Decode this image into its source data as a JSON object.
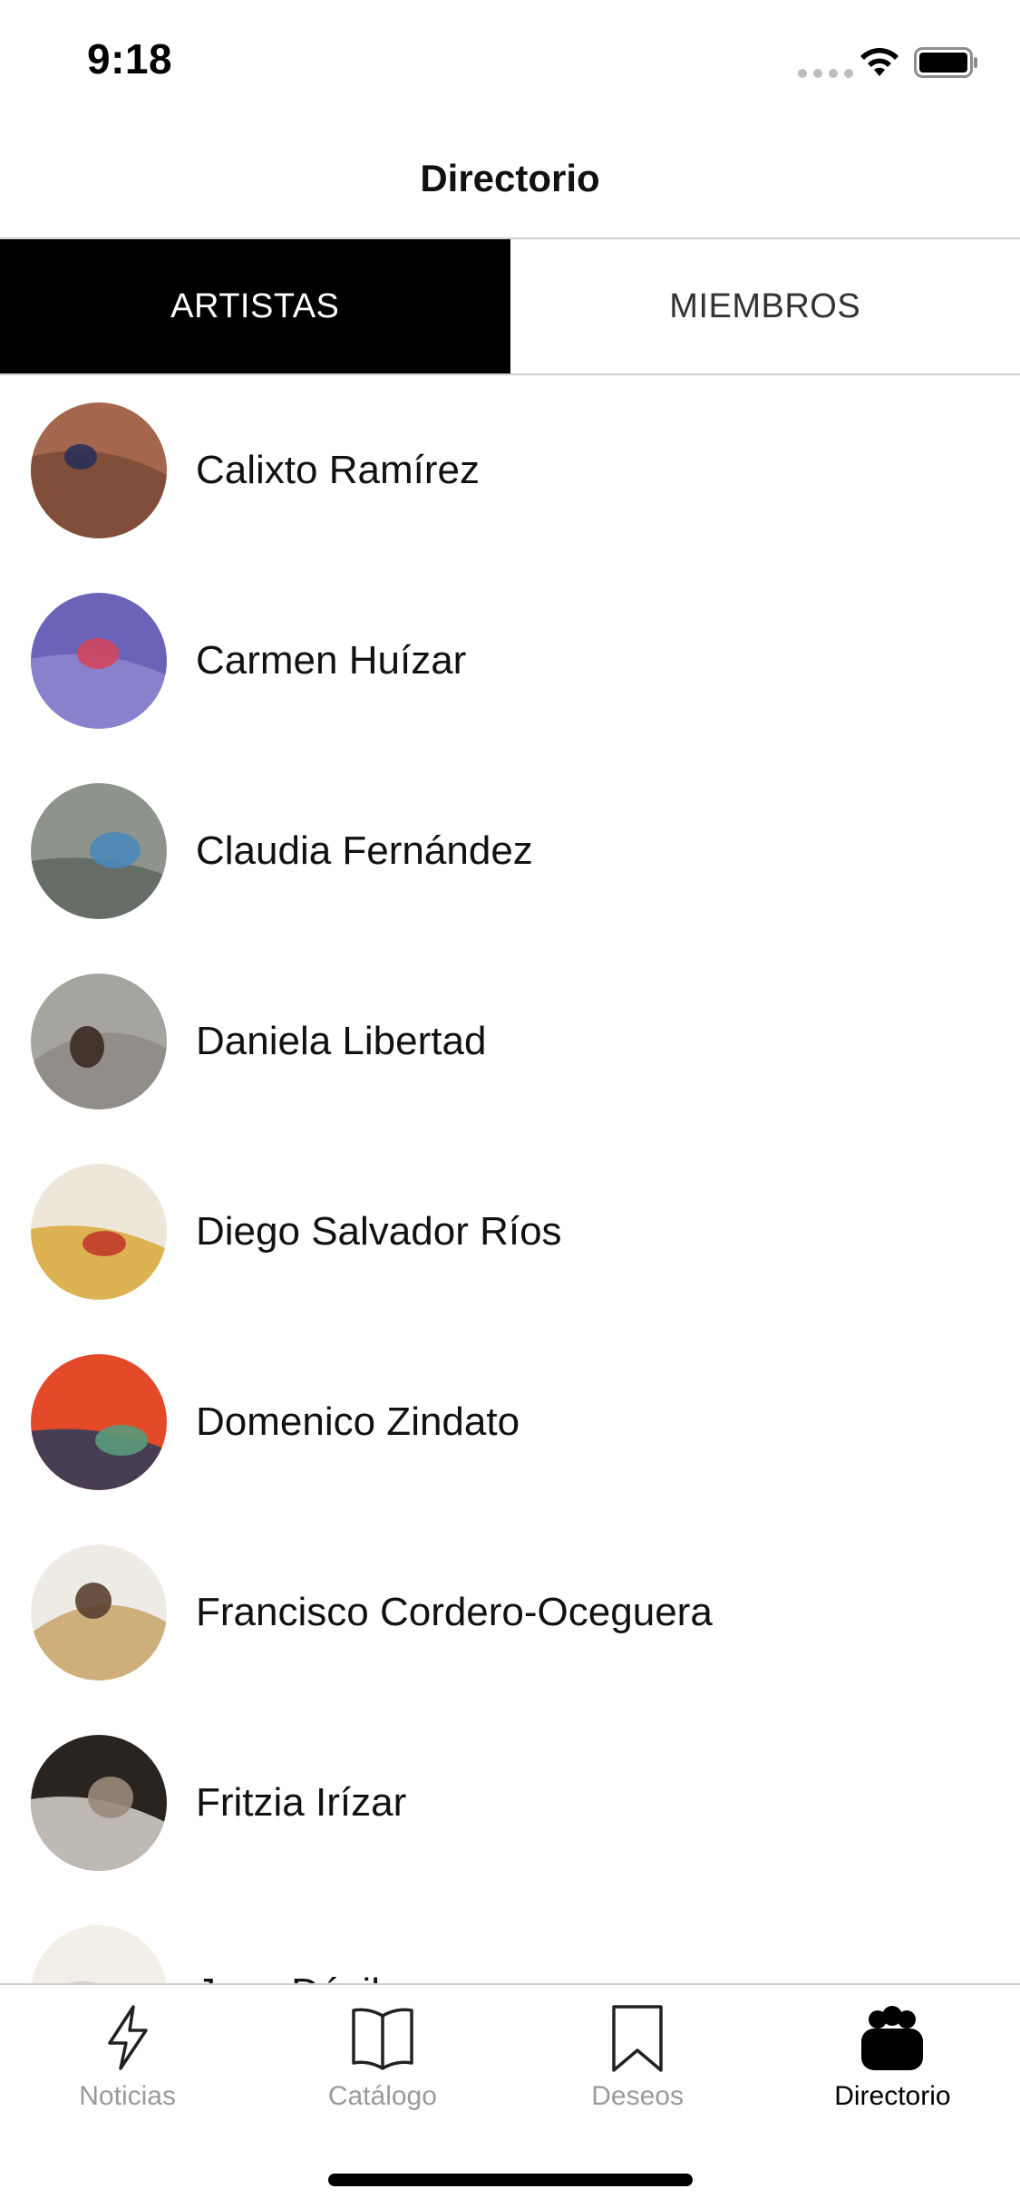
{
  "status_bar": {
    "time": "9:18"
  },
  "header": {
    "title": "Directorio"
  },
  "tabs": [
    {
      "label": "ARTISTAS",
      "active": true
    },
    {
      "label": "MIEMBROS",
      "active": false
    }
  ],
  "artists": [
    {
      "name": "Calixto Ramírez",
      "avatar_colors": [
        "#a4664d",
        "#7a4a36",
        "#2a2f5a"
      ]
    },
    {
      "name": "Carmen Huízar",
      "avatar_colors": [
        "#6a63b8",
        "#8f86cf",
        "#d2465f"
      ]
    },
    {
      "name": "Claudia Fernández",
      "avatar_colors": [
        "#8e948c",
        "#5f655f",
        "#4a88b8"
      ]
    },
    {
      "name": "Daniela Libertad",
      "avatar_colors": [
        "#a6a49f",
        "#8d8a85",
        "#3a2a22"
      ]
    },
    {
      "name": "Diego Salvador Ríos",
      "avatar_colors": [
        "#efe6da",
        "#d9a83a",
        "#c23a2a"
      ]
    },
    {
      "name": "Domenico Zindato",
      "avatar_colors": [
        "#e24a2a",
        "#2c3c5c",
        "#5a9a7a"
      ]
    },
    {
      "name": "Francisco Cordero-Oceguera",
      "avatar_colors": [
        "#eeeae4",
        "#c8a46a",
        "#5a4030"
      ]
    },
    {
      "name": "Fritzia Irízar",
      "avatar_colors": [
        "#2a2420",
        "#d8d4cc",
        "#9a8a7a"
      ]
    },
    {
      "name": "Jose Dávila",
      "avatar_colors": [
        "#f2efe9",
        "#e8d24a",
        "#cfcac2"
      ]
    }
  ],
  "tab_bar": [
    {
      "label": "Noticias",
      "icon": "lightning-icon",
      "active": false
    },
    {
      "label": "Catálogo",
      "icon": "book-icon",
      "active": false
    },
    {
      "label": "Deseos",
      "icon": "bookmark-icon",
      "active": false
    },
    {
      "label": "Directorio",
      "icon": "people-icon",
      "active": true
    }
  ]
}
